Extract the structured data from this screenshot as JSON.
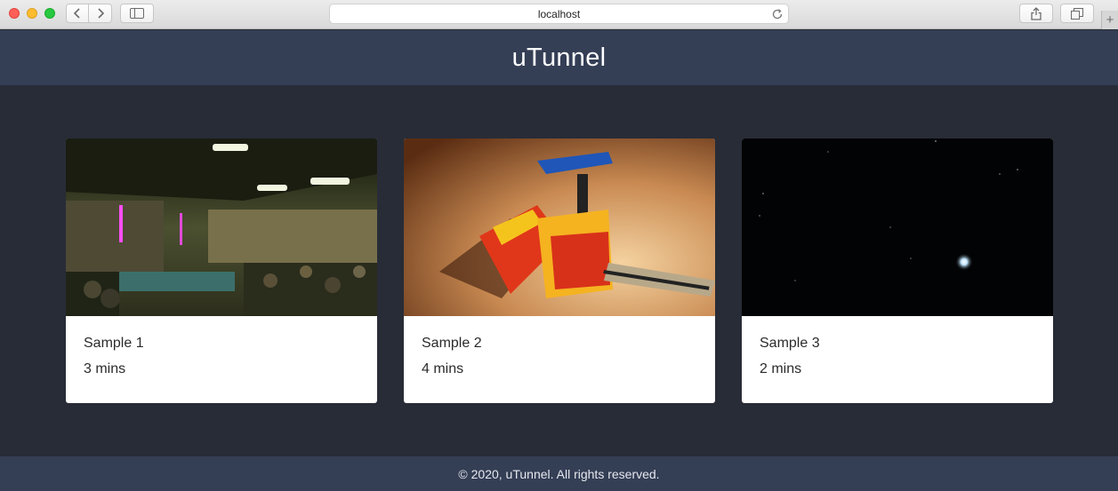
{
  "browser": {
    "url": "localhost",
    "icons": [
      "back-icon",
      "forward-icon",
      "sidebar-icon",
      "reload-icon",
      "share-icon",
      "tabs-icon",
      "plus-icon"
    ]
  },
  "header": {
    "title": "uTunnel"
  },
  "videos": [
    {
      "title": "Sample 1",
      "duration": "3 mins"
    },
    {
      "title": "Sample 2",
      "duration": "4 mins"
    },
    {
      "title": "Sample 3",
      "duration": "2 mins"
    }
  ],
  "footer": {
    "text": "© 2020, uTunnel. All rights reserved."
  },
  "colors": {
    "header_bg": "#343e55",
    "page_bg": "#282c37",
    "card_bg": "#ffffff",
    "title_text": "#ffffff"
  }
}
